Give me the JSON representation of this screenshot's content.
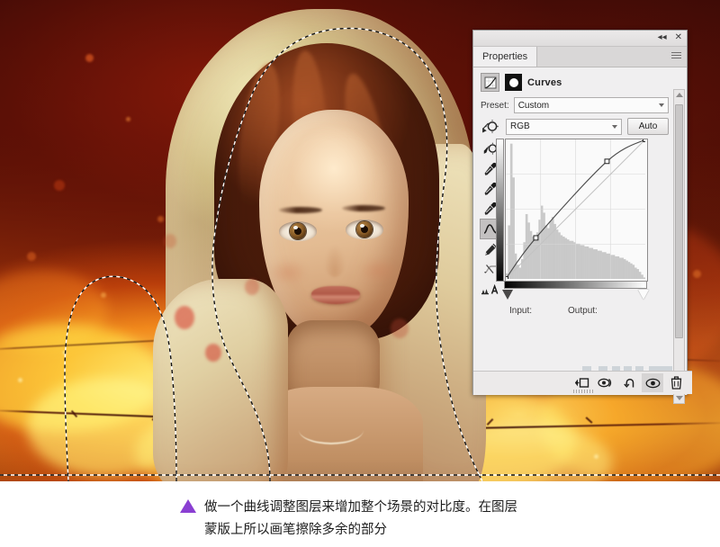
{
  "app": {
    "panel_title": "Properties",
    "adjustment_name": "Curves"
  },
  "panel": {
    "collapse_label": "◂◂",
    "close_label": "✕",
    "menu_icon": "hamburger-menu-icon",
    "adjustment_icon": "curves-adjustment-icon",
    "mask_icon": "layer-mask-thumbnail-icon",
    "preset": {
      "label": "Preset:",
      "value": "Custom"
    },
    "channel": {
      "icon": "targeted-adjustment-icon",
      "value": "RGB"
    },
    "auto_label": "Auto",
    "tools": [
      {
        "name": "targeted-adjustment-tool",
        "selected": false
      },
      {
        "name": "black-point-eyedropper",
        "selected": false
      },
      {
        "name": "gray-point-eyedropper",
        "selected": false
      },
      {
        "name": "white-point-eyedropper",
        "selected": false
      },
      {
        "name": "curve-point-tool",
        "selected": true
      },
      {
        "name": "pencil-draw-tool",
        "selected": false
      },
      {
        "name": "smooth-curve-tool",
        "selected": false
      },
      {
        "name": "clipping-display-tool",
        "selected": false
      }
    ],
    "input_label": "Input:",
    "output_label": "Output:",
    "watermark": "UIII",
    "footer_buttons": [
      {
        "name": "clip-to-layer-button",
        "active": false
      },
      {
        "name": "view-previous-state-button",
        "active": false
      },
      {
        "name": "reset-adjustment-button",
        "active": false
      },
      {
        "name": "toggle-layer-visibility-button",
        "active": true
      },
      {
        "name": "delete-adjustment-layer-button",
        "active": false
      }
    ]
  },
  "chart_data": {
    "type": "line",
    "title": "Curves",
    "xlabel": "Input",
    "ylabel": "Output",
    "xlim": [
      0,
      255
    ],
    "ylim": [
      0,
      255
    ],
    "grid": true,
    "channel": "RGB",
    "control_points": [
      {
        "input": 0,
        "output": 0
      },
      {
        "input": 55,
        "output": 75
      },
      {
        "input": 185,
        "output": 215
      },
      {
        "input": 255,
        "output": 255
      }
    ],
    "baseline": {
      "from": [
        0,
        0
      ],
      "to": [
        255,
        255
      ]
    },
    "histogram": {
      "bins": 64,
      "values": [
        4,
        38,
        96,
        72,
        18,
        10,
        8,
        14,
        26,
        46,
        40,
        34,
        30,
        28,
        33,
        42,
        52,
        47,
        38,
        36,
        41,
        44,
        39,
        35,
        33,
        31,
        30,
        29,
        28,
        27,
        27,
        26,
        25,
        25,
        24,
        24,
        23,
        23,
        22,
        22,
        21,
        21,
        20,
        20,
        19,
        19,
        18,
        18,
        17,
        17,
        16,
        16,
        15,
        15,
        14,
        13,
        12,
        11,
        10,
        8,
        7,
        5,
        3,
        1
      ]
    }
  },
  "canvas": {
    "description": "fire-scene-portrait",
    "selection": "marching-ants-selection"
  },
  "caption": {
    "bullet": "triangle-bullet",
    "bullet_color": "#8a3fd2",
    "line1": "做一个曲线调整图层来增加整个场景的对比度。在图层",
    "line2": "蒙版上所以画笔擦除多余的部分"
  }
}
